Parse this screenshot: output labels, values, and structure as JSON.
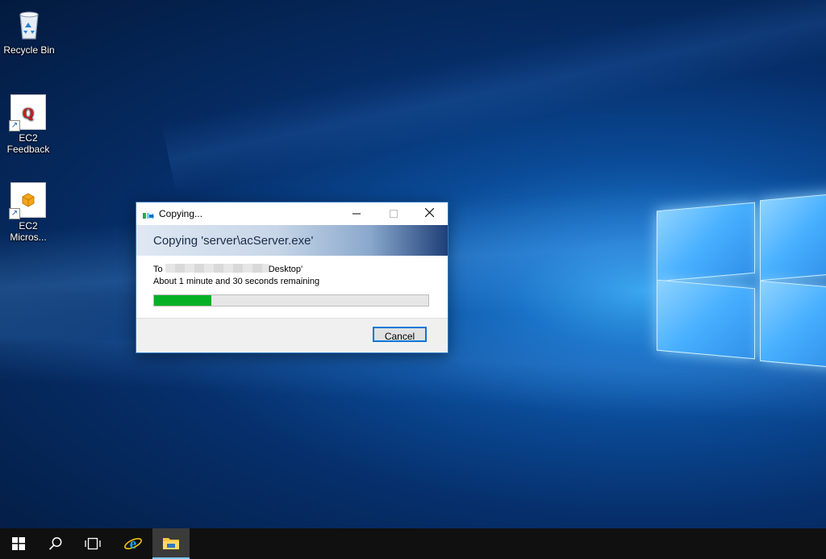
{
  "desktop": {
    "icons": [
      {
        "label": "Recycle Bin"
      },
      {
        "label_line1": "EC2",
        "label_line2": "Feedback"
      },
      {
        "label_line1": "EC2",
        "label_line2": "Micros..."
      }
    ]
  },
  "dialog": {
    "title": "Copying...",
    "header": "Copying 'server\\acServer.exe'",
    "to_prefix": "To",
    "to_suffix": "Desktop'",
    "time_remaining": "About 1 minute and 30 seconds remaining",
    "progress_percent": 21,
    "cancel_label": "Cancel",
    "colors": {
      "progress": "#06b025",
      "accent": "#0078d7"
    }
  },
  "taskbar": {
    "items": [
      "start-icon",
      "search-icon",
      "task-view-icon",
      "internet-explorer-icon",
      "file-explorer-icon"
    ]
  }
}
